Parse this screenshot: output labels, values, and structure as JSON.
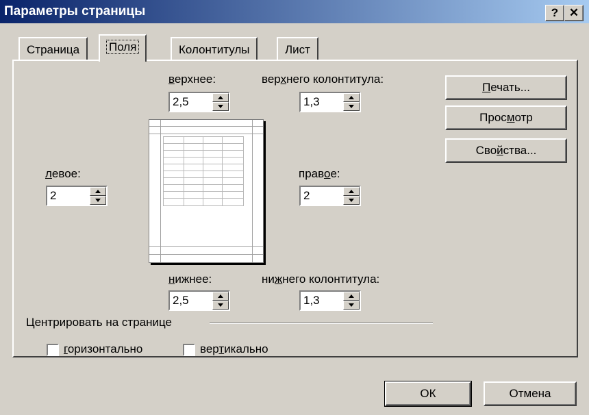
{
  "window": {
    "title": "Параметры страницы",
    "help_glyph": "?",
    "close_glyph": "✕"
  },
  "tabs": [
    {
      "label": "Страница"
    },
    {
      "label": "Поля",
      "active": true
    },
    {
      "label": "Колонтитулы"
    },
    {
      "label": "Лист"
    }
  ],
  "margins": {
    "top": {
      "label_prefix": "",
      "label_hotkey": "в",
      "label_rest": "ерхнее:",
      "value": "2,5"
    },
    "header": {
      "label_prefix": "вер",
      "label_hotkey": "х",
      "label_rest": "него колонтитула:",
      "value": "1,3"
    },
    "left": {
      "label_prefix": "",
      "label_hotkey": "л",
      "label_rest": "евое:",
      "value": "2"
    },
    "right": {
      "label_prefix": "прав",
      "label_hotkey": "о",
      "label_rest": "е:",
      "value": "2"
    },
    "bottom": {
      "label_prefix": "",
      "label_hotkey": "н",
      "label_rest": "ижнее:",
      "value": "2,5"
    },
    "footer": {
      "label_prefix": "ни",
      "label_hotkey": "ж",
      "label_rest": "него колонтитула:",
      "value": "1,3"
    }
  },
  "side_buttons": {
    "print": {
      "prefix": "",
      "hotkey": "П",
      "rest": "ечать..."
    },
    "preview": {
      "prefix": "Прос",
      "hotkey": "м",
      "rest": "отр"
    },
    "properties": {
      "prefix": "Сво",
      "hotkey": "й",
      "rest": "ства..."
    }
  },
  "centering": {
    "group_label": "Центрировать на странице",
    "horizontal": {
      "prefix": "",
      "hotkey": "г",
      "rest": "оризонтально",
      "checked": false
    },
    "vertical": {
      "prefix": "вер",
      "hotkey": "т",
      "rest": "икально",
      "checked": false
    }
  },
  "footer_buttons": {
    "ok": "ОК",
    "cancel": "Отмена"
  }
}
